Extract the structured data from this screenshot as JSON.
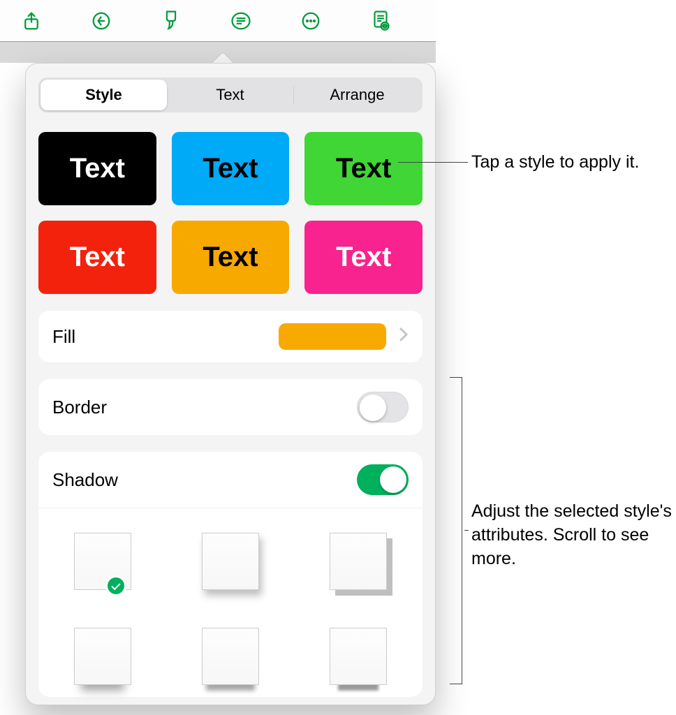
{
  "toolbar": {
    "icons": [
      "share-icon",
      "undo-icon",
      "format-brush-icon",
      "list-icon",
      "more-icon",
      "read-mode-icon"
    ]
  },
  "popover": {
    "tabs": {
      "style": "Style",
      "text": "Text",
      "arrange": "Arrange",
      "selected": "style"
    },
    "styleTileLabel": "Text",
    "styleTiles": [
      {
        "bg": "#000000",
        "fg": "#ffffff"
      },
      {
        "bg": "#00aaf6",
        "fg": "#000000"
      },
      {
        "bg": "#3fd636",
        "fg": "#000000"
      },
      {
        "bg": "#f3220c",
        "fg": "#ffffff"
      },
      {
        "bg": "#f7a900",
        "fg": "#000000"
      },
      {
        "bg": "#f8238e",
        "fg": "#ffffff"
      }
    ],
    "fillLabel": "Fill",
    "fillColor": "#f7a900",
    "borderLabel": "Border",
    "borderOn": false,
    "shadowLabel": "Shadow",
    "shadowOn": true,
    "shadowSelectedIndex": 0,
    "shadowThumbs": [
      {
        "shadow": "none"
      },
      {
        "shadow": "4px 8px 10px rgba(0,0,0,0.25)"
      },
      {
        "shadow": "8px 8px 0 rgba(0,0,0,0.25)"
      },
      {
        "shadow": "0 18px 12px -10px rgba(0,0,0,0.35)"
      },
      {
        "shadow": "0 14px 6px -6px rgba(0,0,0,0.35)"
      },
      {
        "shadow": "0 20px 4px -12px rgba(0,0,0,0.4)"
      }
    ]
  },
  "callouts": {
    "top": "Tap a style to apply it.",
    "bottom": "Adjust the selected style's attributes. Scroll to see more."
  }
}
